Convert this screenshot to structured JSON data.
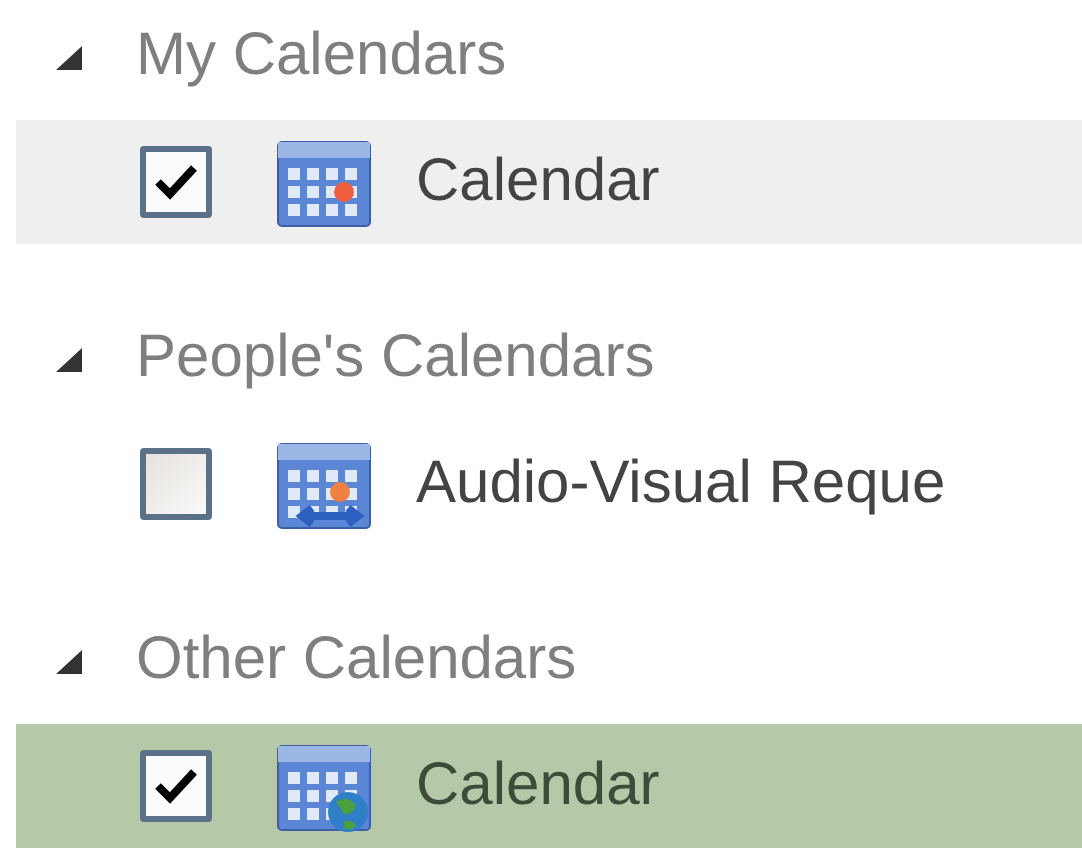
{
  "groups": [
    {
      "title": "My Calendars",
      "expanded": true,
      "items": [
        {
          "name": "Calendar",
          "kind": "calendar",
          "checked": true,
          "hovered": true,
          "selected": false
        }
      ]
    },
    {
      "title": "People's Calendars",
      "expanded": true,
      "items": [
        {
          "name": "Audio-Visual Reque",
          "kind": "shared",
          "checked": false,
          "hovered": false,
          "selected": false
        }
      ]
    },
    {
      "title": "Other Calendars",
      "expanded": true,
      "items": [
        {
          "name": "Calendar",
          "kind": "internet",
          "checked": true,
          "hovered": false,
          "selected": true
        }
      ]
    }
  ]
}
